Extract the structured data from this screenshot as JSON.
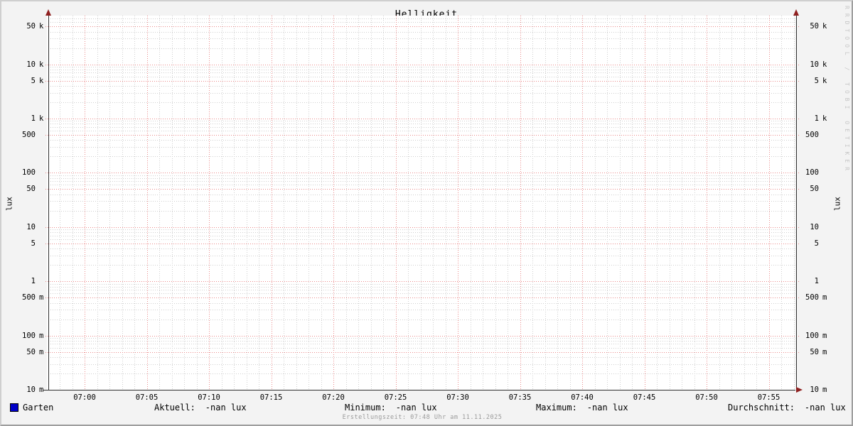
{
  "chart_data": {
    "type": "line",
    "title": "Helligkeit",
    "ylabel_left": "lux",
    "ylabel_right": "lux",
    "y_scale": "log",
    "y_range": [
      0.01,
      79000
    ],
    "x_range": [
      "06:58",
      "07:57"
    ],
    "grid": true,
    "legend_position": "bottom",
    "y_ticks": [
      {
        "num": "50",
        "unit": "k",
        "value": 50000
      },
      {
        "num": "10",
        "unit": "k",
        "value": 10000
      },
      {
        "num": "5",
        "unit": "k",
        "value": 5000
      },
      {
        "num": "1",
        "unit": "k",
        "value": 1000
      },
      {
        "num": "500",
        "unit": "",
        "value": 500
      },
      {
        "num": "100",
        "unit": "",
        "value": 100
      },
      {
        "num": "50",
        "unit": "",
        "value": 50
      },
      {
        "num": "10",
        "unit": "",
        "value": 10
      },
      {
        "num": "5",
        "unit": "",
        "value": 5
      },
      {
        "num": "1",
        "unit": "",
        "value": 1
      },
      {
        "num": "500",
        "unit": "m",
        "value": 0.5
      },
      {
        "num": "100",
        "unit": "m",
        "value": 0.1
      },
      {
        "num": "50",
        "unit": "m",
        "value": 0.05
      },
      {
        "num": "10",
        "unit": "m",
        "value": 0.01
      }
    ],
    "y_minor_mantissas": [
      2,
      3,
      4,
      6,
      7,
      8,
      9
    ],
    "y_minor_decades": [
      -2,
      -1,
      0,
      1,
      2,
      3,
      4
    ],
    "x_ticks": [
      {
        "label": "07:00",
        "minute": 0
      },
      {
        "label": "07:05",
        "minute": 5
      },
      {
        "label": "07:10",
        "minute": 10
      },
      {
        "label": "07:15",
        "minute": 15
      },
      {
        "label": "07:20",
        "minute": 20
      },
      {
        "label": "07:25",
        "minute": 25
      },
      {
        "label": "07:30",
        "minute": 30
      },
      {
        "label": "07:35",
        "minute": 35
      },
      {
        "label": "07:40",
        "minute": 40
      },
      {
        "label": "07:45",
        "minute": 45
      },
      {
        "label": "07:50",
        "minute": 50
      },
      {
        "label": "07:55",
        "minute": 55
      }
    ],
    "x_minor_minutes": {
      "from": -2,
      "to": 57,
      "step": 1
    },
    "series": [
      {
        "name": "Garten",
        "color": "#0000C8",
        "values": []
      }
    ],
    "stats": [
      {
        "label": "Aktuell:",
        "value": "-nan lux"
      },
      {
        "label": "Minimum:",
        "value": "-nan lux"
      },
      {
        "label": "Maximum:",
        "value": "-nan lux"
      },
      {
        "label": "Durchschnitt:",
        "value": "-nan lux"
      }
    ],
    "footer": "Erstellungszeit: 07:48 Uhr am 11.11.2025",
    "watermark": "RRDTOOL / TOBI OETIKER",
    "colors": {
      "background": "#F3F3F3",
      "canvas": "#FFFFFF",
      "major_grid": "#EA8A8A",
      "minor_grid": "#CFCFCF",
      "axis": "#2F2F2F",
      "arrow": "#8F1F1F",
      "text": "#000000",
      "footer_text": "#9A9A9A",
      "watermark_text": "#C6C6C6",
      "shade_top_left": "#CFCFCF",
      "shade_bottom_right": "#9E9E9E",
      "series_garten": "#0000C8"
    }
  }
}
